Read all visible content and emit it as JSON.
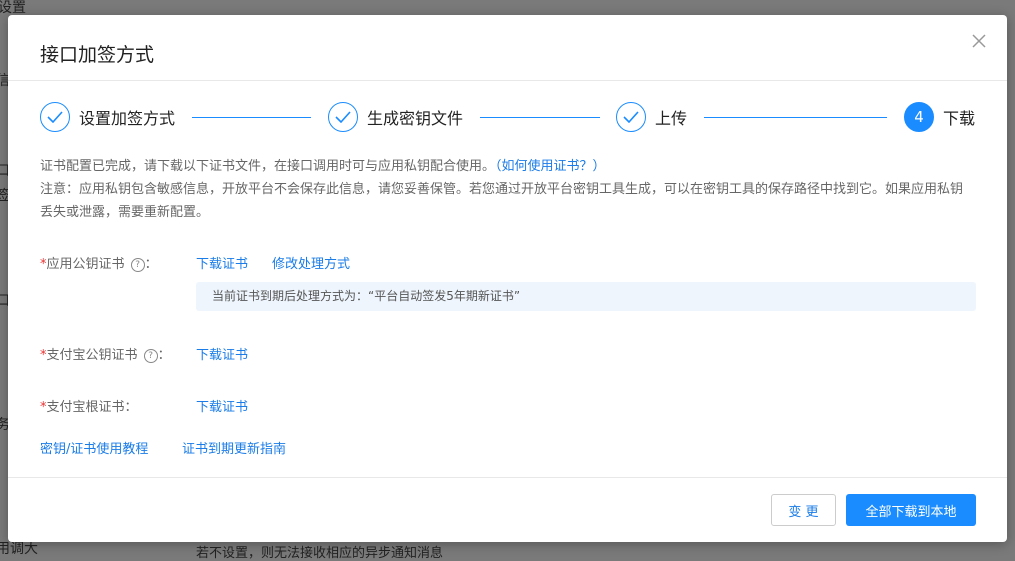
{
  "background": {
    "frags": [
      "设置",
      "信",
      "口",
      "签",
      "口",
      "务",
      "用调大",
      "若不设置，则无法接收相应的异步通知消息"
    ]
  },
  "modal": {
    "title": "接口加签方式",
    "close_icon": "close-icon"
  },
  "steps": [
    {
      "label": "设置加签方式",
      "status": "done"
    },
    {
      "label": "生成密钥文件",
      "status": "done"
    },
    {
      "label": "上传",
      "status": "done"
    },
    {
      "label": "下载",
      "status": "active",
      "number": "4"
    }
  ],
  "info": {
    "line1": "证书配置已完成，请下载以下证书文件，在接口调用时可与应用私钥配合使用。",
    "help_link": "（如何使用证书？）",
    "note": "注意：应用私钥包含敏感信息，开放平台不会保存此信息，请您妥善保管。若您通过开放平台密钥工具生成，可以在密钥工具的保存路径中找到它。如果应用私钥丢失或泄露，需要重新配置。"
  },
  "fields": {
    "app_cert": {
      "required": "*",
      "label": "应用公钥证书",
      "colon": "：",
      "download": "下载证书",
      "modify": "修改处理方式",
      "notice": "当前证书到期后处理方式为：“平台自动签发5年期新证书”"
    },
    "alipay_cert": {
      "required": "*",
      "label": "支付宝公钥证书",
      "colon": "：",
      "download": "下载证书"
    },
    "root_cert": {
      "required": "*",
      "label": "支付宝根证书：",
      "download": "下载证书"
    }
  },
  "links": {
    "tutorial": "密钥/证书使用教程",
    "renew_guide": "证书到期更新指南"
  },
  "footer": {
    "change": "变 更",
    "download_all": "全部下载到本地"
  },
  "colors": {
    "accent": "#1a8cff",
    "link": "#1a7ce8",
    "required": "#e33333"
  }
}
